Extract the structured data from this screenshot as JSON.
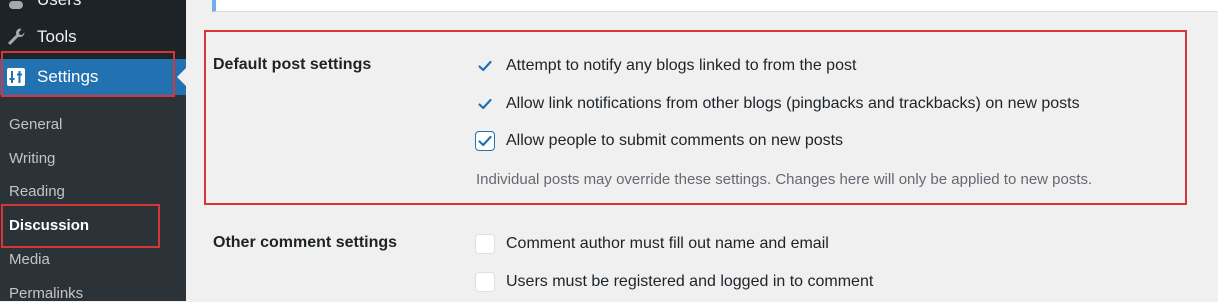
{
  "sidebar": {
    "users_label": "Users",
    "tools_label": "Tools",
    "settings_label": "Settings",
    "submenu": [
      {
        "label": "General"
      },
      {
        "label": "Writing"
      },
      {
        "label": "Reading"
      },
      {
        "label": "Discussion",
        "current": true
      },
      {
        "label": "Media"
      },
      {
        "label": "Permalinks"
      }
    ]
  },
  "default_post": {
    "label": "Default post settings",
    "options": [
      {
        "label": "Attempt to notify any blogs linked to from the post",
        "checked": true
      },
      {
        "label": "Allow link notifications from other blogs (pingbacks and trackbacks) on new posts",
        "checked": true
      },
      {
        "label": "Allow people to submit comments on new posts",
        "checked": true
      }
    ],
    "description": "Individual posts may override these settings. Changes here will only be applied to new posts."
  },
  "other_comment": {
    "label": "Other comment settings",
    "options": [
      {
        "label": "Comment author must fill out name and email",
        "checked": false
      },
      {
        "label": "Users must be registered and logged in to comment",
        "checked": false
      }
    ]
  },
  "colors": {
    "sidebar_bg": "#1d2327",
    "submenu_bg": "#2c3338",
    "accent": "#2271b1",
    "highlight_border": "#d63638"
  },
  "icons": {
    "users": "users-icon",
    "tools": "wrench-icon",
    "settings": "settings-icon",
    "check": "checkmark-icon"
  }
}
